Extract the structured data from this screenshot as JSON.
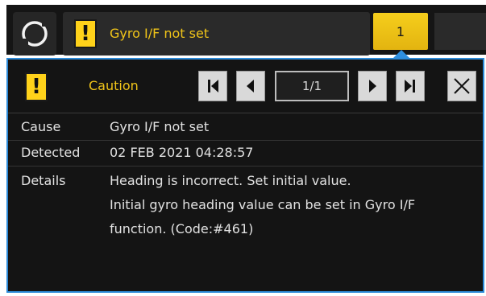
{
  "topbar": {
    "ring_icon": "ring-icon",
    "alert_icon": "exclamation-icon",
    "alert_text": "Gyro I/F not set",
    "alert_count": "1"
  },
  "panel": {
    "severity_icon": "exclamation-icon",
    "severity_label": "Caution",
    "page_indicator": "1/1",
    "nav_icons": [
      "first-page-icon",
      "prev-icon",
      "next-icon",
      "last-page-icon"
    ],
    "close_icon": "close-icon",
    "rows": {
      "cause": {
        "label": "Cause",
        "value": "Gyro I/F not set"
      },
      "detected": {
        "label": "Detected",
        "value": "02 FEB 2021 04:28:57"
      },
      "details": {
        "label": "Details",
        "lines": [
          "Heading is incorrect. Set initial value.",
          "Initial gyro heading value can be set in Gyro I/F",
          "function. (Code:#461)"
        ]
      }
    }
  },
  "colors": {
    "caution_yellow": "#f0c419",
    "tab_yellow": "#f5ce1c",
    "panel_border": "#2c8ad8",
    "background": "#141414"
  }
}
